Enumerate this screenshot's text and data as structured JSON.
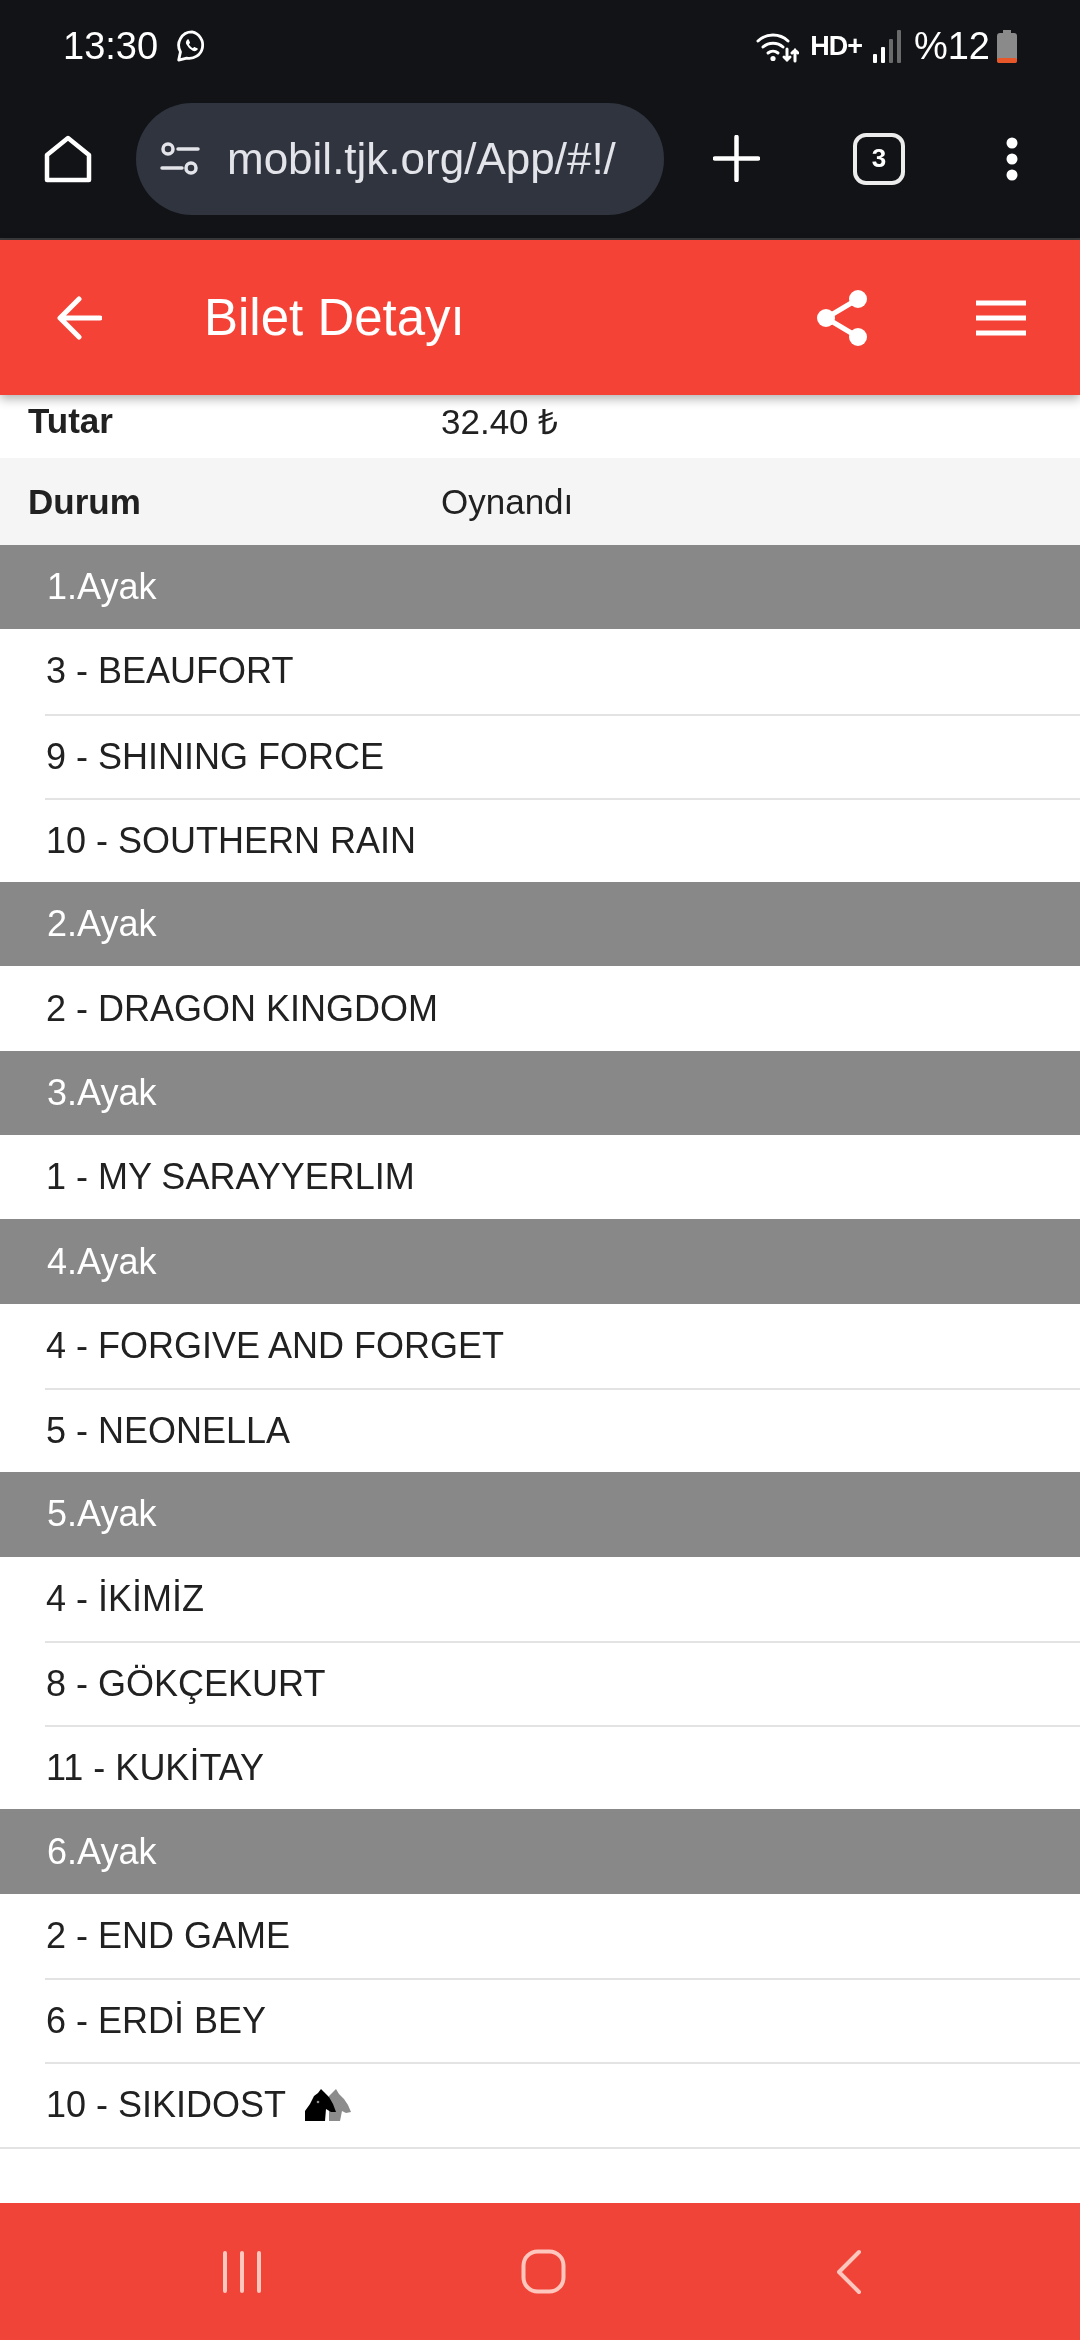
{
  "status_bar": {
    "time": "13:30",
    "network_label": "HD+",
    "battery_text": "%12"
  },
  "browser_toolbar": {
    "url": "mobil.tjk.org/App/#!/",
    "tab_count": "3"
  },
  "app_bar": {
    "title": "Bilet Detayı"
  },
  "summary": [
    {
      "label": "Tutar",
      "value": "32.40 ₺"
    },
    {
      "label": "Durum",
      "value": "Oynandı"
    }
  ],
  "legs": [
    {
      "title": "1.Ayak",
      "horses": [
        {
          "name": "3 - BEAUFORT",
          "kind": "plain"
        },
        {
          "name": "9 - SHINING FORCE",
          "kind": "plain"
        },
        {
          "name": "10 - SOUTHERN RAIN",
          "kind": "plain"
        }
      ]
    },
    {
      "title": "2.Ayak",
      "horses": [
        {
          "name": "2 - DRAGON KINGDOM",
          "kind": "plain"
        }
      ]
    },
    {
      "title": "3.Ayak",
      "horses": [
        {
          "name": "1 - MY SARAYYERLIM",
          "kind": "plain"
        }
      ]
    },
    {
      "title": "4.Ayak",
      "horses": [
        {
          "name": "4 - FORGIVE AND FORGET",
          "kind": "plain"
        },
        {
          "name": "5 - NEONELLA",
          "kind": "plain"
        }
      ]
    },
    {
      "title": "5.Ayak",
      "horses": [
        {
          "name": "4 - İKİMİZ",
          "kind": "plain"
        },
        {
          "name": "8 - GÖKÇEKURT",
          "kind": "plain"
        },
        {
          "name": "11 - KUKİTAY",
          "kind": "plain"
        }
      ]
    },
    {
      "title": "6.Ayak",
      "horses": [
        {
          "name": "2 - END GAME",
          "kind": "plain"
        },
        {
          "name": "6 - ERDİ BEY",
          "kind": "plain"
        },
        {
          "name": "10 - SIKIDOST",
          "kind": "marked"
        }
      ]
    }
  ]
}
